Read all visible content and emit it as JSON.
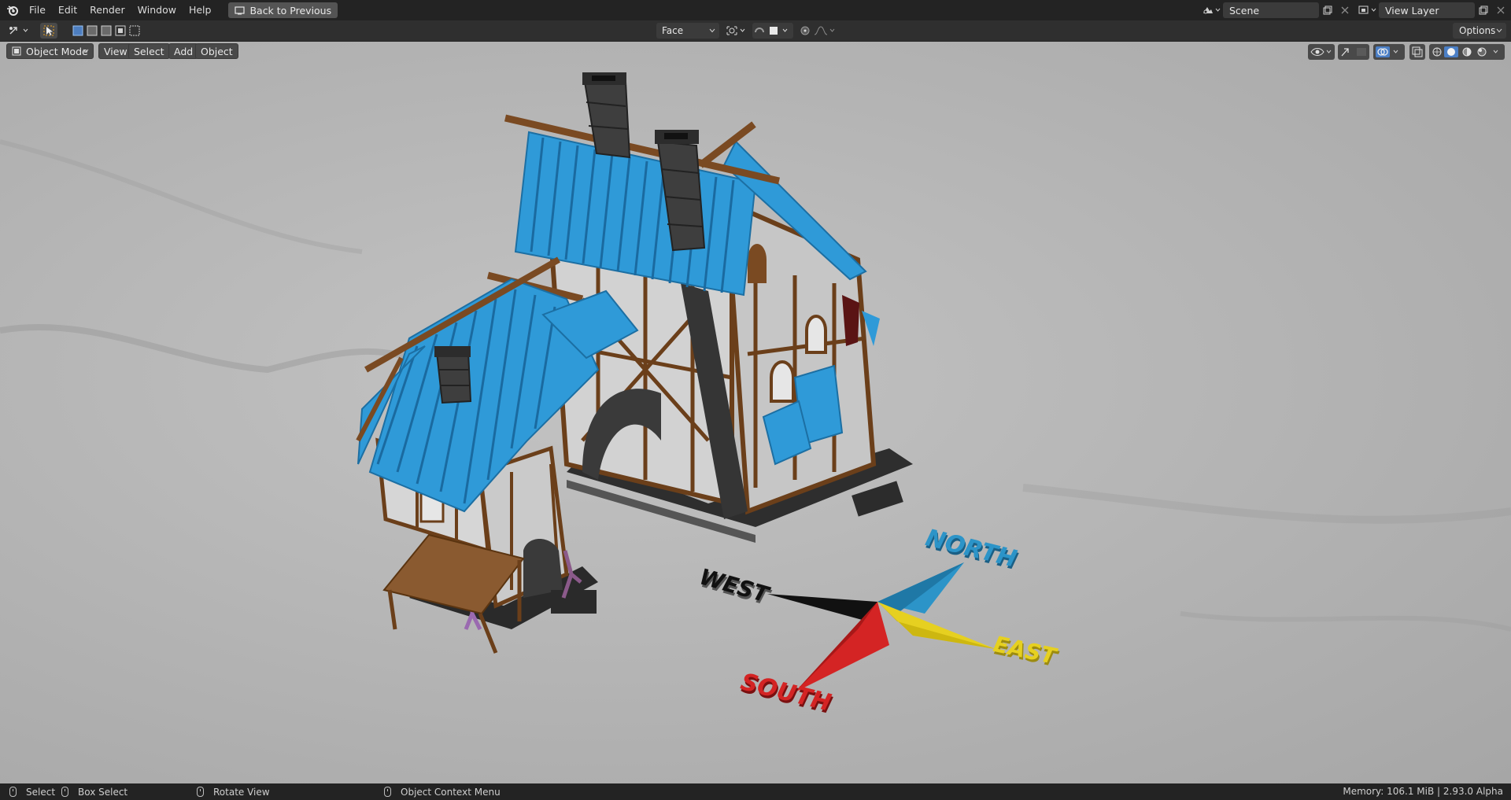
{
  "topbar": {
    "menus": [
      "File",
      "Edit",
      "Render",
      "Window",
      "Help"
    ],
    "back_button": "Back to Previous",
    "scene_field": "Scene",
    "view_layer_field": "View Layer"
  },
  "tool_settings": {
    "snap_target": "Face",
    "options_label": "Options"
  },
  "viewport_header": {
    "mode": "Object Mode",
    "menus": [
      "View",
      "Select",
      "Add",
      "Object"
    ]
  },
  "compass_labels": {
    "north": "NORTH",
    "south": "SOUTH",
    "east": "EAST",
    "west": "WEST"
  },
  "colors": {
    "roof_blue": "#2f9ad8",
    "timber_brown": "#7a4a22",
    "stone_dark": "#3b3b3b",
    "wall_grey": "#cfcfcf",
    "compass_north": "#2c94c8",
    "compass_south": "#d42424",
    "compass_east": "#e6d020",
    "compass_west": "#111111"
  },
  "statusbar": {
    "select": "Select",
    "box_select": "Box Select",
    "rotate_view": "Rotate View",
    "context_menu": "Object Context Menu",
    "memory": "Memory: 106.1 MiB | 2.93.0 Alpha"
  }
}
